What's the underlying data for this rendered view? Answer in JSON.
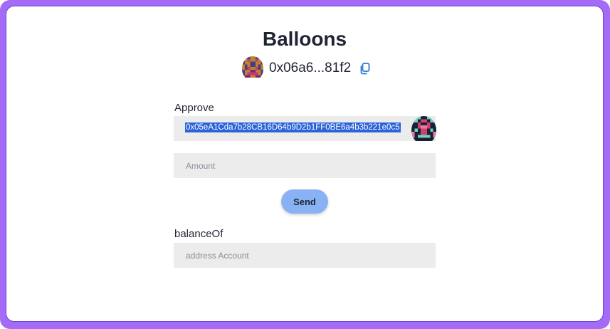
{
  "page": {
    "title": "Balloons"
  },
  "account": {
    "address_short": "0x06a6...81f2",
    "copy_icon": "copy-icon",
    "avatar_icon": "blockie-avatar"
  },
  "approve": {
    "label": "Approve",
    "spender_value": "0x05eA1Cda7b28CB16D64b9D2b1FF0BE6a4b3b221e0c5",
    "spender_avatar_icon": "blockie-avatar",
    "amount_placeholder": "Amount",
    "send_label": "Send"
  },
  "balance_of": {
    "label": "balanceOf",
    "address_placeholder": "address Account"
  },
  "colors": {
    "frame": "#a46cf6",
    "selection": "#2b63d9",
    "button": "#89b2f5",
    "input_bg": "#ececec",
    "copy_icon": "#2b7bd6"
  }
}
